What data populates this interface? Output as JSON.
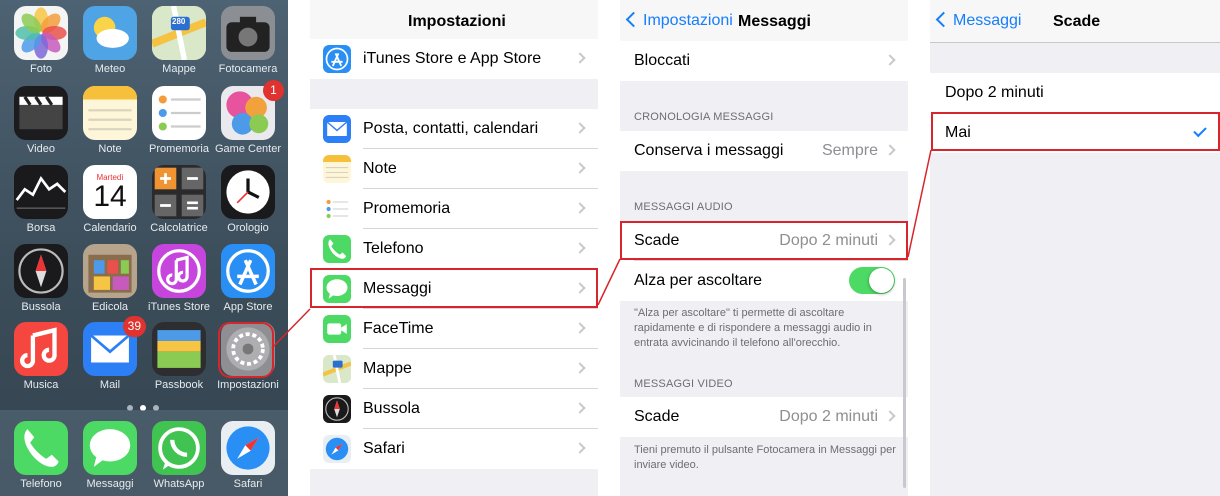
{
  "home": {
    "apps": [
      {
        "label": "Foto",
        "icon": "photos-icon",
        "color": "#f4f4f4"
      },
      {
        "label": "Meteo",
        "icon": "weather-icon",
        "color": "#4fa4e6"
      },
      {
        "label": "Mappe",
        "icon": "maps-icon",
        "color": "#e8efe0",
        "sign": "280"
      },
      {
        "label": "Fotocamera",
        "icon": "camera-icon",
        "color": "#8b8f93"
      },
      {
        "label": "Video",
        "icon": "video-icon",
        "color": "#1c1c1e"
      },
      {
        "label": "Note",
        "icon": "notes-icon",
        "color": "#fdf6d8"
      },
      {
        "label": "Promemoria",
        "icon": "reminders-icon",
        "color": "#ffffff"
      },
      {
        "label": "Game Center",
        "icon": "game-center-icon",
        "color": "#e9e9ee",
        "badge": "1"
      },
      {
        "label": "Borsa",
        "icon": "stocks-icon",
        "color": "#1a1a1c"
      },
      {
        "label": "Calendario",
        "icon": "calendar-icon",
        "color": "#ffffff",
        "day_name": "Martedì",
        "day": "14"
      },
      {
        "label": "Calcolatrice",
        "icon": "calculator-icon",
        "color": "#2b2b2d"
      },
      {
        "label": "Orologio",
        "icon": "clock-icon",
        "color": "#1a1a1c"
      },
      {
        "label": "Bussola",
        "icon": "compass-icon",
        "color": "#1a1a1c"
      },
      {
        "label": "Edicola",
        "icon": "newsstand-icon",
        "color": "#b6a48c"
      },
      {
        "label": "iTunes Store",
        "icon": "itunes-store-icon",
        "color": "#c645dd"
      },
      {
        "label": "App Store",
        "icon": "app-store-icon",
        "color": "#2a8ff4"
      },
      {
        "label": "Musica",
        "icon": "music-icon",
        "color": "#f5463f"
      },
      {
        "label": "Mail",
        "icon": "mail-icon",
        "color": "#2d7ff6",
        "badge": "39"
      },
      {
        "label": "Passbook",
        "icon": "passbook-icon",
        "color": "#2e2e30"
      },
      {
        "label": "Impostazioni",
        "icon": "settings-icon",
        "color": "#8e8e93"
      }
    ],
    "dock": [
      {
        "label": "Telefono",
        "icon": "phone-icon",
        "color": "#4cd964"
      },
      {
        "label": "Messaggi",
        "icon": "messages-icon",
        "color": "#4cd964"
      },
      {
        "label": "WhatsApp",
        "icon": "whatsapp-icon",
        "color": "#40c351"
      },
      {
        "label": "Safari",
        "icon": "safari-icon",
        "color": "#e9eef3"
      }
    ]
  },
  "settings": {
    "title": "Impostazioni",
    "rows": [
      {
        "label": "iTunes Store e App Store",
        "icon": "app-store-icon",
        "color": "#2a8ff4"
      },
      {
        "label": "Posta, contatti, calendari",
        "icon": "mail-icon",
        "color": "#2d7ff6"
      },
      {
        "label": "Note",
        "icon": "notes-icon",
        "color": "#fdf6d8"
      },
      {
        "label": "Promemoria",
        "icon": "reminders-icon",
        "color": "#ffffff"
      },
      {
        "label": "Telefono",
        "icon": "phone-icon",
        "color": "#4cd964"
      },
      {
        "label": "Messaggi",
        "icon": "messages-icon",
        "color": "#4cd964"
      },
      {
        "label": "FaceTime",
        "icon": "facetime-icon",
        "color": "#4cd964"
      },
      {
        "label": "Mappe",
        "icon": "maps-icon",
        "color": "#e8efe0"
      },
      {
        "label": "Bussola",
        "icon": "compass-icon",
        "color": "#1a1a1c"
      },
      {
        "label": "Safari",
        "icon": "safari-icon",
        "color": "#e9eef3"
      }
    ]
  },
  "messaggi": {
    "back_label": "Impostazioni",
    "title": "Messaggi",
    "blocked_label": "Bloccati",
    "history_header": "CRONOLOGIA MESSAGGI",
    "keep_label": "Conserva i messaggi",
    "keep_value": "Sempre",
    "audio_header": "MESSAGGI AUDIO",
    "audio_expire_label": "Scade",
    "audio_expire_value": "Dopo 2 minuti",
    "raise_label": "Alza per ascoltare",
    "raise_on": true,
    "raise_note": "\"Alza per ascoltare\" ti permette di ascoltare rapidamente e di rispondere a messaggi audio in entrata avvicinando il telefono all'orecchio.",
    "video_header": "MESSAGGI VIDEO",
    "video_expire_label": "Scade",
    "video_expire_value": "Dopo 2 minuti",
    "video_note": "Tieni premuto il pulsante Fotocamera in Messaggi per inviare video."
  },
  "scade": {
    "back_label": "Messaggi",
    "title": "Scade",
    "options": [
      "Dopo 2 minuti",
      "Mai"
    ],
    "selected": "Mai"
  },
  "colors": {
    "accent": "#157efb",
    "highlight": "#d7262b",
    "toggle_on": "#4cd964"
  }
}
